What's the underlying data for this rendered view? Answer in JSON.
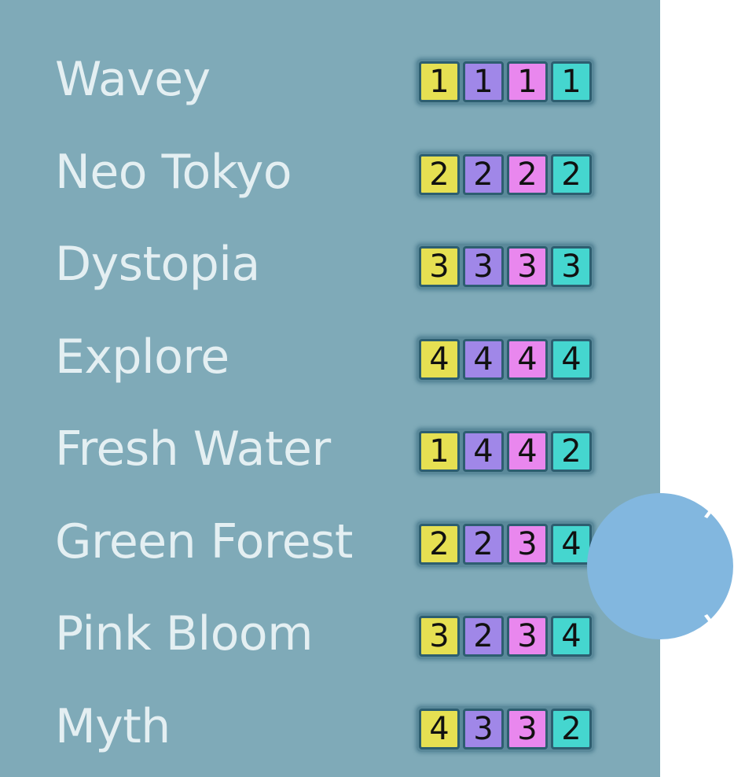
{
  "presets": [
    {
      "name": "Wavey",
      "tiles": [
        "1",
        "1",
        "1",
        "1"
      ]
    },
    {
      "name": "Neo Tokyo",
      "tiles": [
        "2",
        "2",
        "2",
        "2"
      ]
    },
    {
      "name": "Dystopia",
      "tiles": [
        "3",
        "3",
        "3",
        "3"
      ]
    },
    {
      "name": "Explore",
      "tiles": [
        "4",
        "4",
        "4",
        "4"
      ]
    },
    {
      "name": "Fresh Water",
      "tiles": [
        "1",
        "4",
        "4",
        "2"
      ]
    },
    {
      "name": "Green Forest",
      "tiles": [
        "2",
        "2",
        "3",
        "4"
      ]
    },
    {
      "name": "Pink Bloom",
      "tiles": [
        "3",
        "2",
        "3",
        "4"
      ]
    },
    {
      "name": "Myth",
      "tiles": [
        "4",
        "3",
        "3",
        "2"
      ]
    }
  ],
  "colors": {
    "panel_background": "#7faab8",
    "text": "#e4eff2",
    "tile_column_colors": [
      "#e6e052",
      "#a087e8",
      "#e987ee",
      "#45d6cf"
    ],
    "knob": "#82b7df"
  }
}
